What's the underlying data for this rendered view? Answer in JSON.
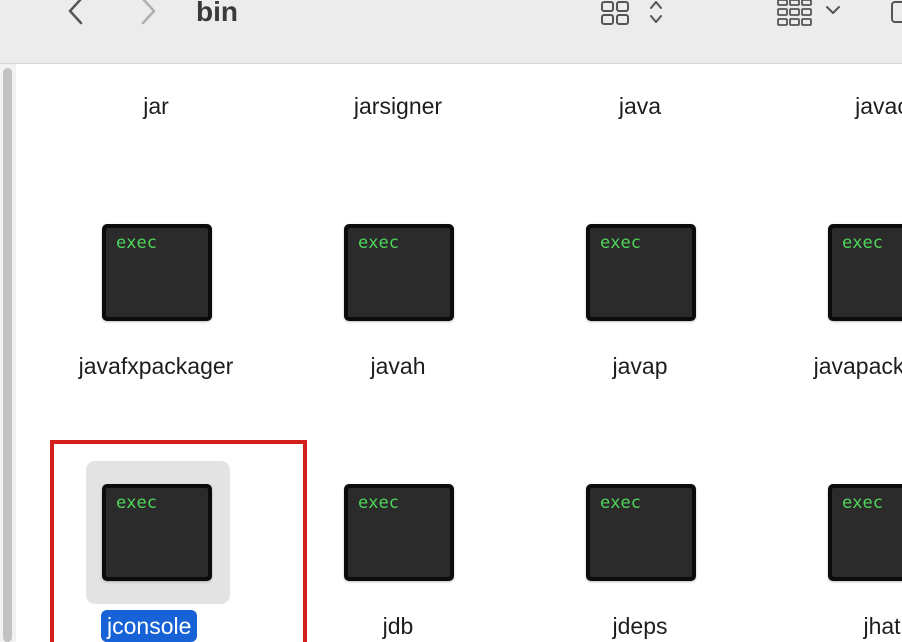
{
  "toolbar": {
    "folder_title": "bin",
    "back_icon": "chevron-left-icon",
    "forward_icon": "chevron-right-icon",
    "view_icon": "icon-grid-icon",
    "group_icon": "group-icon",
    "share_icon": "share-icon"
  },
  "files": [
    {
      "name": "jar",
      "icon": "exec"
    },
    {
      "name": "jarsigner",
      "icon": "exec"
    },
    {
      "name": "java",
      "icon": "exec"
    },
    {
      "name": "javac",
      "icon": "exec"
    },
    {
      "name": "javafxpackager",
      "icon": "exec"
    },
    {
      "name": "javah",
      "icon": "exec"
    },
    {
      "name": "javap",
      "icon": "exec"
    },
    {
      "name": "javapackager",
      "icon": "exec"
    },
    {
      "name": "jconsole",
      "icon": "exec",
      "selected": true
    },
    {
      "name": "jdb",
      "icon": "exec"
    },
    {
      "name": "jdeps",
      "icon": "exec"
    },
    {
      "name": "jhat",
      "icon": "exec"
    }
  ],
  "colors": {
    "selection": "#1662d6",
    "highlight_box": "#d21f1b",
    "exec_text": "#4fd65a"
  }
}
